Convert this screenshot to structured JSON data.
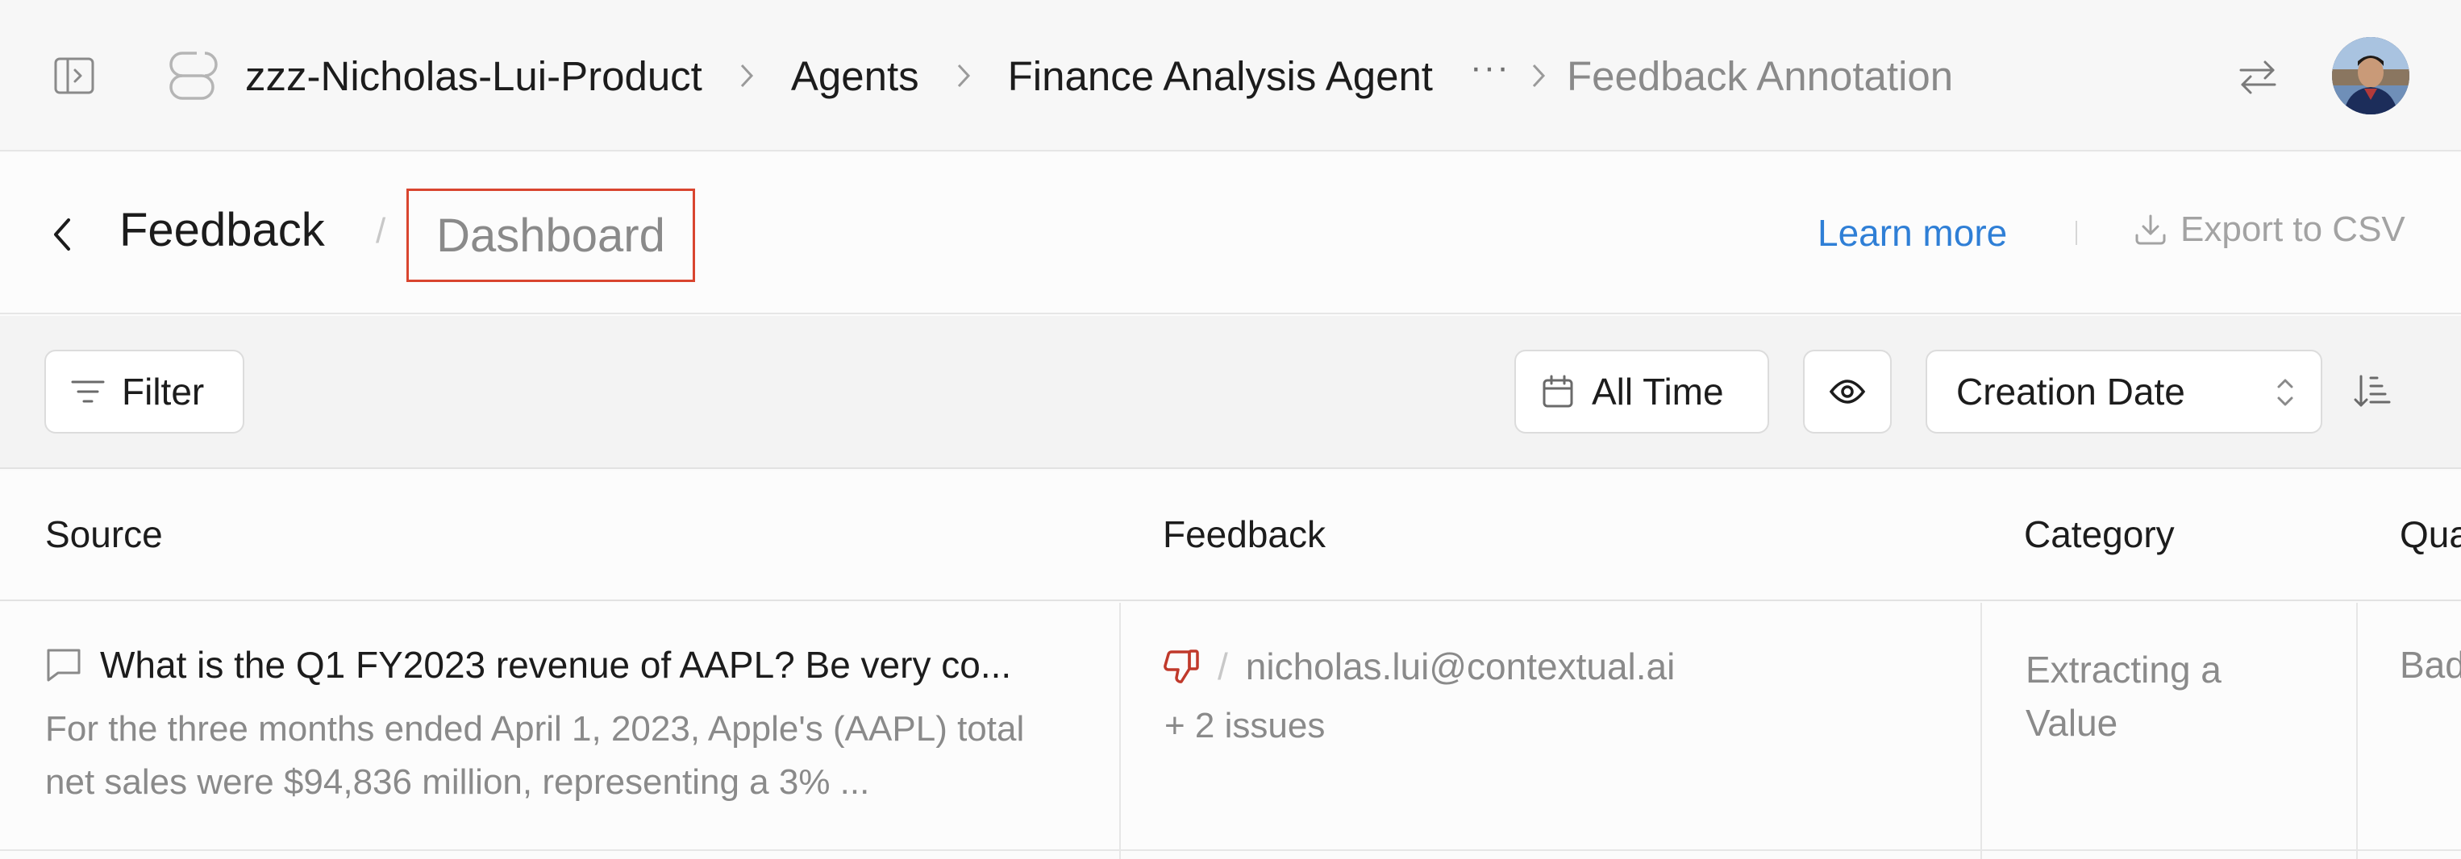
{
  "topbar": {
    "workspace": "zzz-Nicholas-Lui-Product",
    "breadcrumbs": [
      "Agents",
      "Finance Analysis Agent"
    ],
    "more": "···",
    "current": "Feedback Annotation"
  },
  "header": {
    "title": "Feedback",
    "separator": "/",
    "active_tab": "Dashboard",
    "learn_more": "Learn more",
    "export": "Export to CSV"
  },
  "toolbar": {
    "filter_label": "Filter",
    "time_range": "All Time",
    "sort_by": "Creation Date"
  },
  "table": {
    "columns": [
      "Source",
      "Feedback",
      "Category",
      "Qua"
    ],
    "rows": [
      {
        "title": "What is the Q1 FY2023 revenue of AAPL? Be very co...",
        "description": "For the three months ended April 1, 2023, Apple's (AAPL) total net sales were $94,836 million, representing a 3% ...",
        "feedback_sep": "/",
        "feedback_user": "nicholas.lui@contextual.ai",
        "feedback_issues": "+ 2 issues",
        "category": "Extracting a Value",
        "quality": "Bad"
      }
    ]
  },
  "colors": {
    "accent_link": "#2f7fd6",
    "highlight_border": "#d9452f",
    "thumbs_down": "#c0392b"
  }
}
